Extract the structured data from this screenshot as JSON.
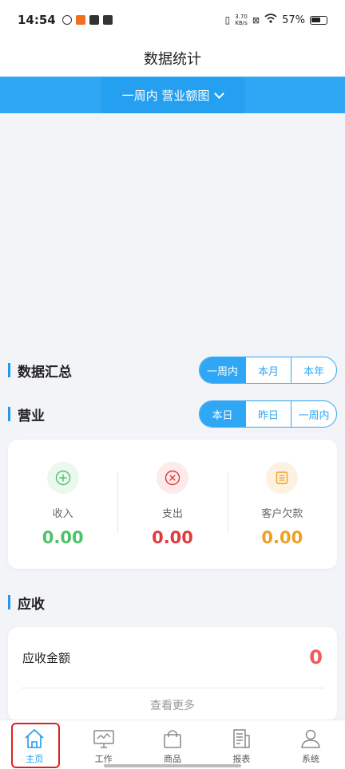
{
  "status_bar": {
    "time": "14:54",
    "net_speed": "3.70",
    "net_unit": "KB/s",
    "battery": "57%"
  },
  "header": {
    "title": "数据统计"
  },
  "period_select": {
    "label": "一周内 营业额图"
  },
  "summary": {
    "title": "数据汇总",
    "options": [
      "一周内",
      "本月",
      "本年"
    ],
    "active": "一周内"
  },
  "business": {
    "title": "营业",
    "options": [
      "本日",
      "昨日",
      "一周内"
    ],
    "active": "本日"
  },
  "stats": [
    {
      "label": "收入",
      "value": "0.00",
      "color": "#4cc36a",
      "icon": "plus-circle-icon"
    },
    {
      "label": "支出",
      "value": "0.00",
      "color": "#e03b3b",
      "icon": "close-circle-icon"
    },
    {
      "label": "客户欠款",
      "value": "0.00",
      "color": "#eda022",
      "icon": "document-icon"
    }
  ],
  "receivable": {
    "title": "应收",
    "label": "应收金额",
    "value": "0",
    "more": "查看更多"
  },
  "tabbar": {
    "items": [
      {
        "label": "主页",
        "icon": "home-icon"
      },
      {
        "label": "工作",
        "icon": "monitor-icon"
      },
      {
        "label": "商品",
        "icon": "bag-icon"
      },
      {
        "label": "报表",
        "icon": "report-icon"
      },
      {
        "label": "系统",
        "icon": "user-icon"
      }
    ],
    "active": "主页"
  },
  "colors": {
    "accent": "#2fa7f5",
    "highlight": "#e02020"
  }
}
